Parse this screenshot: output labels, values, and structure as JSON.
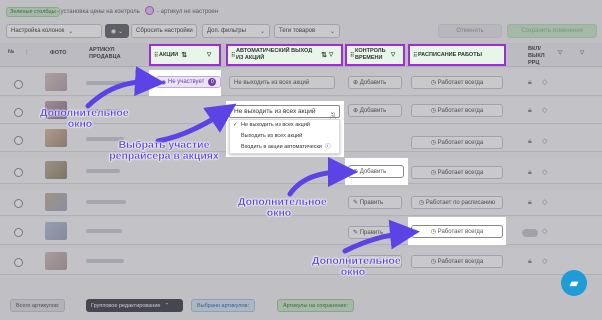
{
  "legend": {
    "green_tag": "Зеленые столбцы",
    "green_text": "- установка цены на контроль",
    "purple_text": "- артикул не настроен"
  },
  "toolbar": {
    "columns_label": "Настройка колонок",
    "reset_label": "Сбросить настройки",
    "filters_label": "Доп. фильтры",
    "tags_label": "Теги товаров",
    "cancel_label": "Отменить",
    "save_label": "Сохранить изменения"
  },
  "table": {
    "headers": {
      "no": "№",
      "photo": "ФОТО",
      "article": "АРТИКУЛ ПРОДАВЦА",
      "actions": "АКЦИИ",
      "auto_exit": "АВТОМАТИЧЕСКИЙ ВЫХОД ИЗ АКЦИЙ",
      "time_control": "КОНТРОЛЬ ВРЕМЕНИ",
      "schedule": "РАСПИСАНИЕ РАБОТЫ",
      "rrc": "ВКЛ/ВЫКЛ РРЦ"
    },
    "cells": {
      "not_participating": "Не участвует",
      "not_participating_count": "0",
      "auto_exit_value": "Не выходить из всех акций",
      "add": "Добавить",
      "edit": "Править",
      "works_always": "Работает всегда",
      "by_schedule": "Работает по расписанию"
    }
  },
  "dropdown": {
    "selected": "Не выходить из всех акций",
    "options": [
      "Не выходить из всех акций",
      "Выходить из всех акций",
      "Входить в акции автоматически"
    ]
  },
  "annotations": {
    "extra_window_1": "Дополнительное окно",
    "select_participation": "Выбрать участие репрайсера в акциях",
    "extra_window_2": "Дополнительное окно",
    "extra_window_3": "Дополнительное окно"
  },
  "footer": {
    "total": "Всего артикулов:",
    "group_edit": "Групповое редактирование",
    "selected": "Выбрано артикулов:",
    "saving": "Артикулы на сохранение:"
  },
  "colors": {
    "accent_purple": "#9b2fd6",
    "annotation": "#5b43e6",
    "green_column": "#e8f6ea",
    "chat": "#1f9bd6"
  }
}
